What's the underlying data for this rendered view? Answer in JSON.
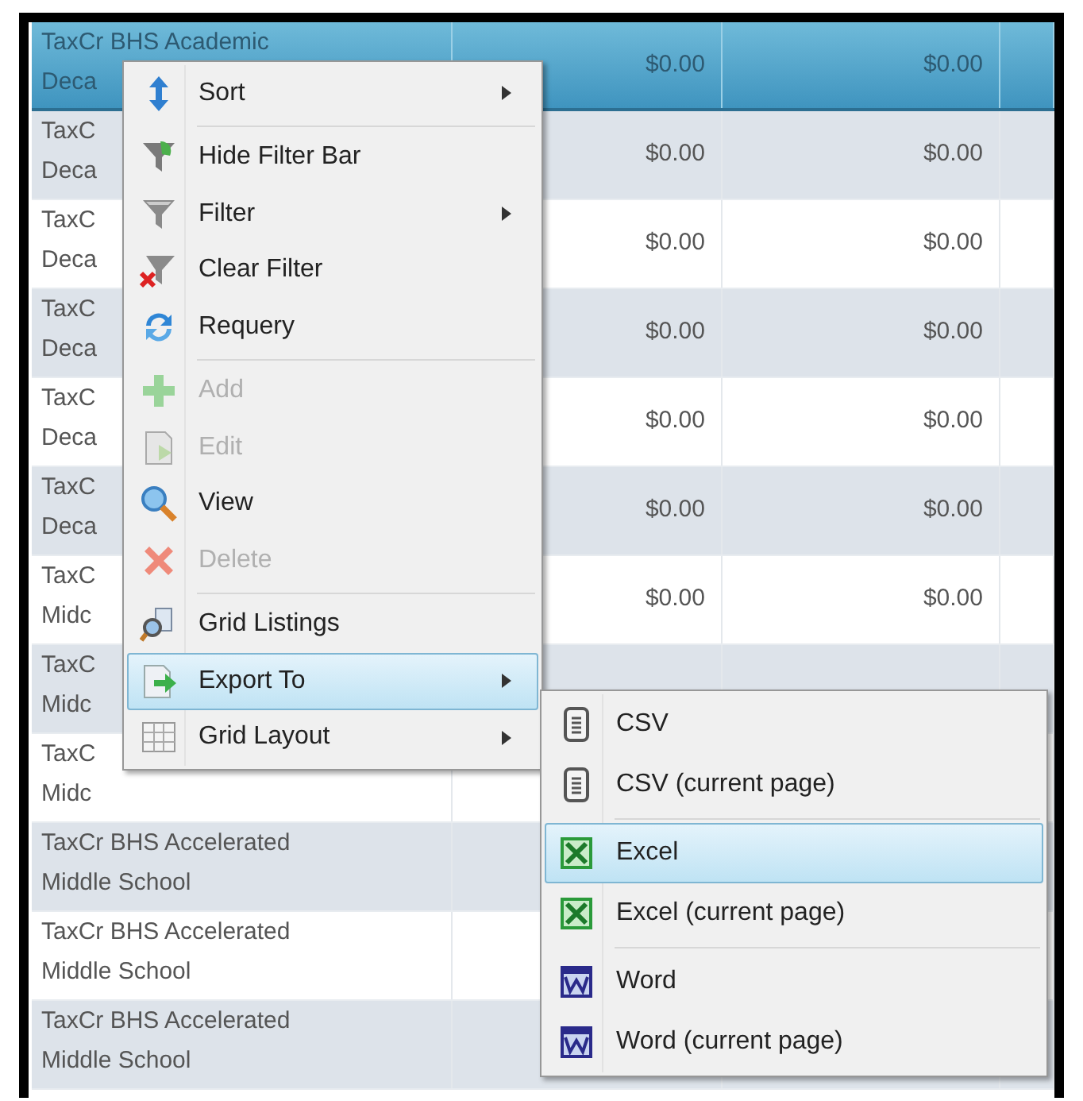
{
  "grid": {
    "rows": [
      {
        "name": [
          "TaxCr BHS Academic",
          "Deca"
        ],
        "values": [
          "$0.00",
          "$0.00"
        ],
        "selected": true
      },
      {
        "name": [
          "TaxC",
          "Deca"
        ],
        "values": [
          "$0.00",
          "$0.00"
        ],
        "selected": false
      },
      {
        "name": [
          "TaxC",
          "Deca"
        ],
        "values": [
          "$0.00",
          "$0.00"
        ],
        "selected": false
      },
      {
        "name": [
          "TaxC",
          "Deca"
        ],
        "values": [
          "$0.00",
          "$0.00"
        ],
        "selected": false
      },
      {
        "name": [
          "TaxC",
          "Deca"
        ],
        "values": [
          "$0.00",
          "$0.00"
        ],
        "selected": false
      },
      {
        "name": [
          "TaxC",
          "Deca"
        ],
        "values": [
          "$0.00",
          "$0.00"
        ],
        "selected": false
      },
      {
        "name": [
          "TaxC",
          "Midc"
        ],
        "values": [
          "$0.00",
          "$0.00"
        ],
        "selected": false
      },
      {
        "name": [
          "TaxC",
          "Midc"
        ],
        "values": [],
        "selected": false
      },
      {
        "name": [
          "TaxC",
          "Midc"
        ],
        "values": [],
        "selected": false
      },
      {
        "name": [
          "TaxCr BHS Accelerated",
          "Middle School"
        ],
        "values": [],
        "selected": false
      },
      {
        "name": [
          "TaxCr BHS Accelerated",
          "Middle School"
        ],
        "values": [],
        "selected": false
      },
      {
        "name": [
          "TaxCr BHS Accelerated",
          "Middle School"
        ],
        "values": [],
        "selected": false
      }
    ]
  },
  "context_menu": {
    "items": [
      {
        "kind": "item",
        "label": "Sort",
        "disabled": false,
        "selected": false,
        "submenu": true
      },
      {
        "kind": "separator"
      },
      {
        "kind": "item",
        "label": "Hide Filter Bar",
        "disabled": false,
        "selected": false,
        "submenu": false
      },
      {
        "kind": "item",
        "label": "Filter",
        "disabled": false,
        "selected": false,
        "submenu": true
      },
      {
        "kind": "item",
        "label": "Clear Filter",
        "disabled": false,
        "selected": false,
        "submenu": false
      },
      {
        "kind": "item",
        "label": "Requery",
        "disabled": false,
        "selected": false,
        "submenu": false
      },
      {
        "kind": "separator"
      },
      {
        "kind": "item",
        "label": "Add",
        "disabled": true,
        "selected": false,
        "submenu": false
      },
      {
        "kind": "item",
        "label": "Edit",
        "disabled": true,
        "selected": false,
        "submenu": false
      },
      {
        "kind": "item",
        "label": "View",
        "disabled": false,
        "selected": false,
        "submenu": false
      },
      {
        "kind": "item",
        "label": "Delete",
        "disabled": true,
        "selected": false,
        "submenu": false
      },
      {
        "kind": "separator"
      },
      {
        "kind": "item",
        "label": "Grid Listings",
        "disabled": false,
        "selected": false,
        "submenu": false
      },
      {
        "kind": "item",
        "label": "Export To",
        "disabled": false,
        "selected": true,
        "submenu": true
      },
      {
        "kind": "item",
        "label": "Grid Layout",
        "disabled": false,
        "selected": false,
        "submenu": true
      }
    ]
  },
  "export_submenu": {
    "items": [
      {
        "kind": "item",
        "label": "CSV",
        "selected": false
      },
      {
        "kind": "item",
        "label": "CSV (current page)",
        "selected": false
      },
      {
        "kind": "separator"
      },
      {
        "kind": "item",
        "label": "Excel",
        "selected": true
      },
      {
        "kind": "item",
        "label": "Excel (current page)",
        "selected": false
      },
      {
        "kind": "separator"
      },
      {
        "kind": "item",
        "label": "Word",
        "selected": false
      },
      {
        "kind": "item",
        "label": "Word (current page)",
        "selected": false
      }
    ]
  }
}
